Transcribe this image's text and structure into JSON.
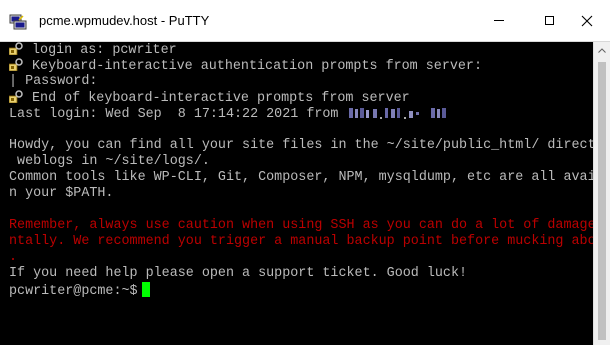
{
  "window": {
    "title": "pcme.wpmudev.host - PuTTY",
    "icons": {
      "app": "putty-icon",
      "minimize": "minimize-icon",
      "maximize": "maximize-icon",
      "close": "close-icon",
      "key": "key-icon",
      "scroll_up": "chevron-up-icon"
    }
  },
  "terminal": {
    "colors": {
      "background": "#000000",
      "text": "#bbbbbb",
      "warning": "#bb0000",
      "cursor": "#00ff00"
    },
    "login_as": "login as: pcwriter",
    "keyboard_interactive": "Keyboard-interactive authentication prompts from server:",
    "password_prompt": "| Password:",
    "end_keyboard_interactive": "End of keyboard-interactive prompts from server",
    "last_login": "Last login: Wed Sep  8 17:14:22 2021 from",
    "howdy_1": "Howdy, you can find all your site files in the ~/site/public_html/ directo",
    "howdy_2": " weblogs in ~/site/logs/.",
    "tools_1": "Common tools like WP-CLI, Git, Composer, NPM, mysqldump, etc are all avail",
    "tools_2": "n your $PATH.",
    "warning_1": "Remember, always use caution when using SSH as you can do a lot of damage",
    "warning_2": "ntally. We recommend you trigger a manual backup point before mucking abou",
    "warning_3": ".",
    "help": "If you need help please open a support ticket. Good luck!",
    "prompt": "pcwriter@pcme:~$"
  }
}
